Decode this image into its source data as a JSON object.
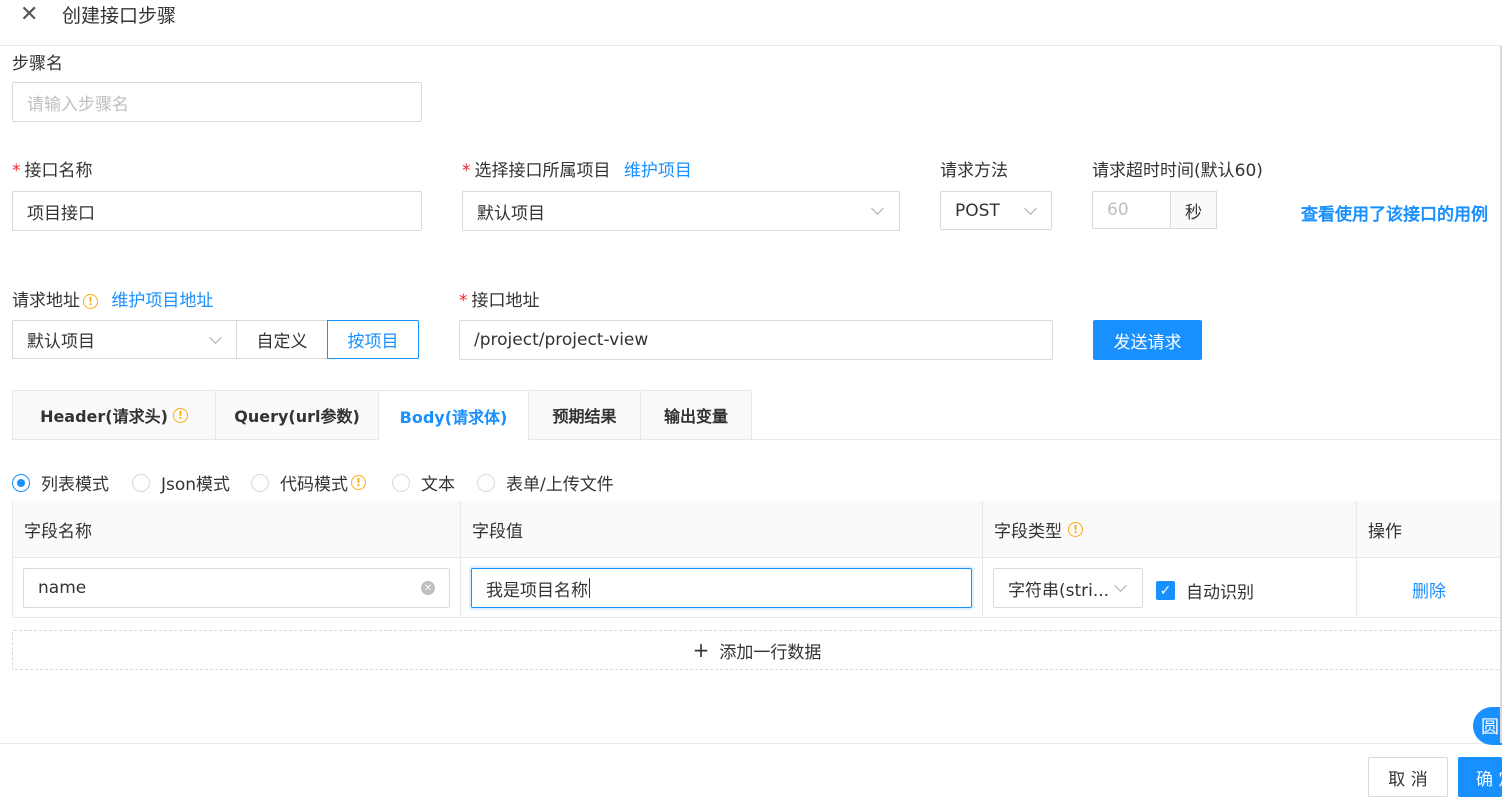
{
  "header": {
    "title": "创建接口步骤"
  },
  "step_name": {
    "label": "步骤名",
    "placeholder": "请输入步骤名",
    "value": ""
  },
  "interface_name": {
    "label": "接口名称",
    "value": "项目接口"
  },
  "project_select": {
    "label": "选择接口所属项目",
    "link": "维护项目",
    "value": "默认项目"
  },
  "method": {
    "label": "请求方法",
    "value": "POST"
  },
  "timeout": {
    "label": "请求超时时间(默认60)",
    "placeholder": "60",
    "unit": "秒"
  },
  "usage_link": "查看使用了该接口的用例",
  "request_address": {
    "label": "请求地址",
    "link": "维护项目地址",
    "select_value": "默认项目",
    "option_custom": "自定义",
    "option_by_project": "按项目"
  },
  "api_address": {
    "label": "接口地址",
    "value": "/project/project-view"
  },
  "send_button": "发送请求",
  "tabs": [
    "Header(请求头)",
    "Query(url参数)",
    "Body(请求体)",
    "预期结果",
    "输出变量"
  ],
  "active_tab": "Body(请求体)",
  "body_modes": [
    "列表模式",
    "Json模式",
    "代码模式",
    "文本",
    "表单/上传文件"
  ],
  "selected_mode": "列表模式",
  "table": {
    "columns": [
      "字段名称",
      "字段值",
      "字段类型",
      "操作"
    ],
    "rows": [
      {
        "name": "name",
        "value": "我是项目名称",
        "type": "字符串(stri...",
        "auto_label": "自动识别",
        "auto_checked": true,
        "action": "删除"
      }
    ]
  },
  "add_row": "添加一行数据",
  "footer": {
    "cancel": "取 消",
    "confirm": "确 定"
  },
  "float_button": "圆",
  "colors": {
    "primary": "#1890ff",
    "required": "#f5222d",
    "info": "#faad14",
    "border": "#d9d9d9"
  }
}
